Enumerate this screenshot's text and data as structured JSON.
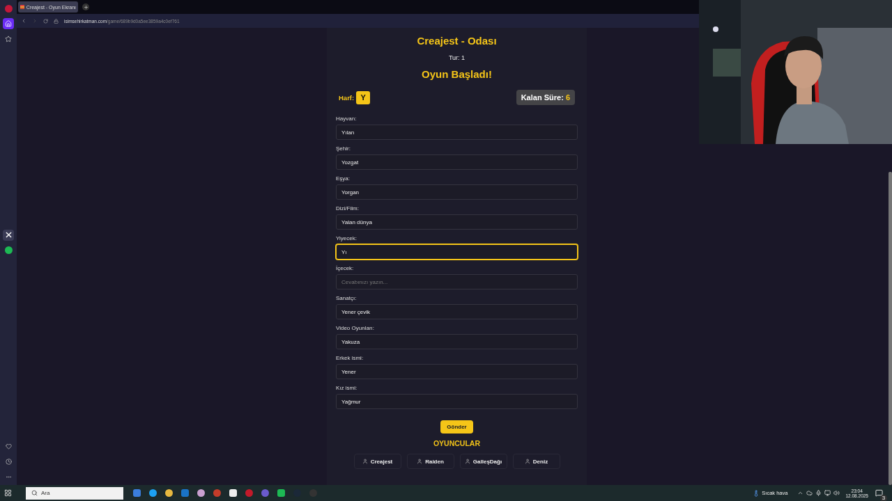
{
  "browser": {
    "tab_title": "Creajest - Oyun Ekranı",
    "url_host": "isimsehirkatman.com",
    "url_path": "/game/689b9d0a5ee3859a4c0ef761"
  },
  "room": {
    "title": "Creajest - Odası",
    "round": "Tur: 1",
    "status": "Oyun Başladı!",
    "letter_label": "Harf:",
    "letter": "Y",
    "time_label": "Kalan Süre:",
    "time_value": "6"
  },
  "fields": [
    {
      "label": "Hayvan:",
      "value": "Yılan",
      "focused": false
    },
    {
      "label": "Şehir:",
      "value": "Yozgat",
      "focused": false
    },
    {
      "label": "Eşya:",
      "value": "Yorgan",
      "focused": false
    },
    {
      "label": "Dizi/Film:",
      "value": "Yalan dünya",
      "focused": false
    },
    {
      "label": "Yiyecek:",
      "value": "Yı",
      "focused": true
    },
    {
      "label": "İçecek:",
      "placeholder": "Cevabınızı yazın...",
      "focused": false
    },
    {
      "label": "Sanatçı:",
      "value": "Yener çevik",
      "focused": false
    },
    {
      "label": "Video Oyunları:",
      "value": "Yakuza",
      "focused": false
    },
    {
      "label": "Erkek ismi:",
      "value": "Yener",
      "focused": false
    },
    {
      "label": "Kız ismi:",
      "value": "Yağmur",
      "focused": false
    }
  ],
  "submit": "Gönder",
  "players_title": "OYUNCULAR",
  "players": [
    "Creajest",
    "Raiden",
    "GalleşDağı",
    "Deniz"
  ],
  "taskbar": {
    "search_placeholder": "Ara",
    "weather": "Sıcak hava",
    "time": "23:04",
    "date": "12.08.2025",
    "notifications": "3"
  }
}
